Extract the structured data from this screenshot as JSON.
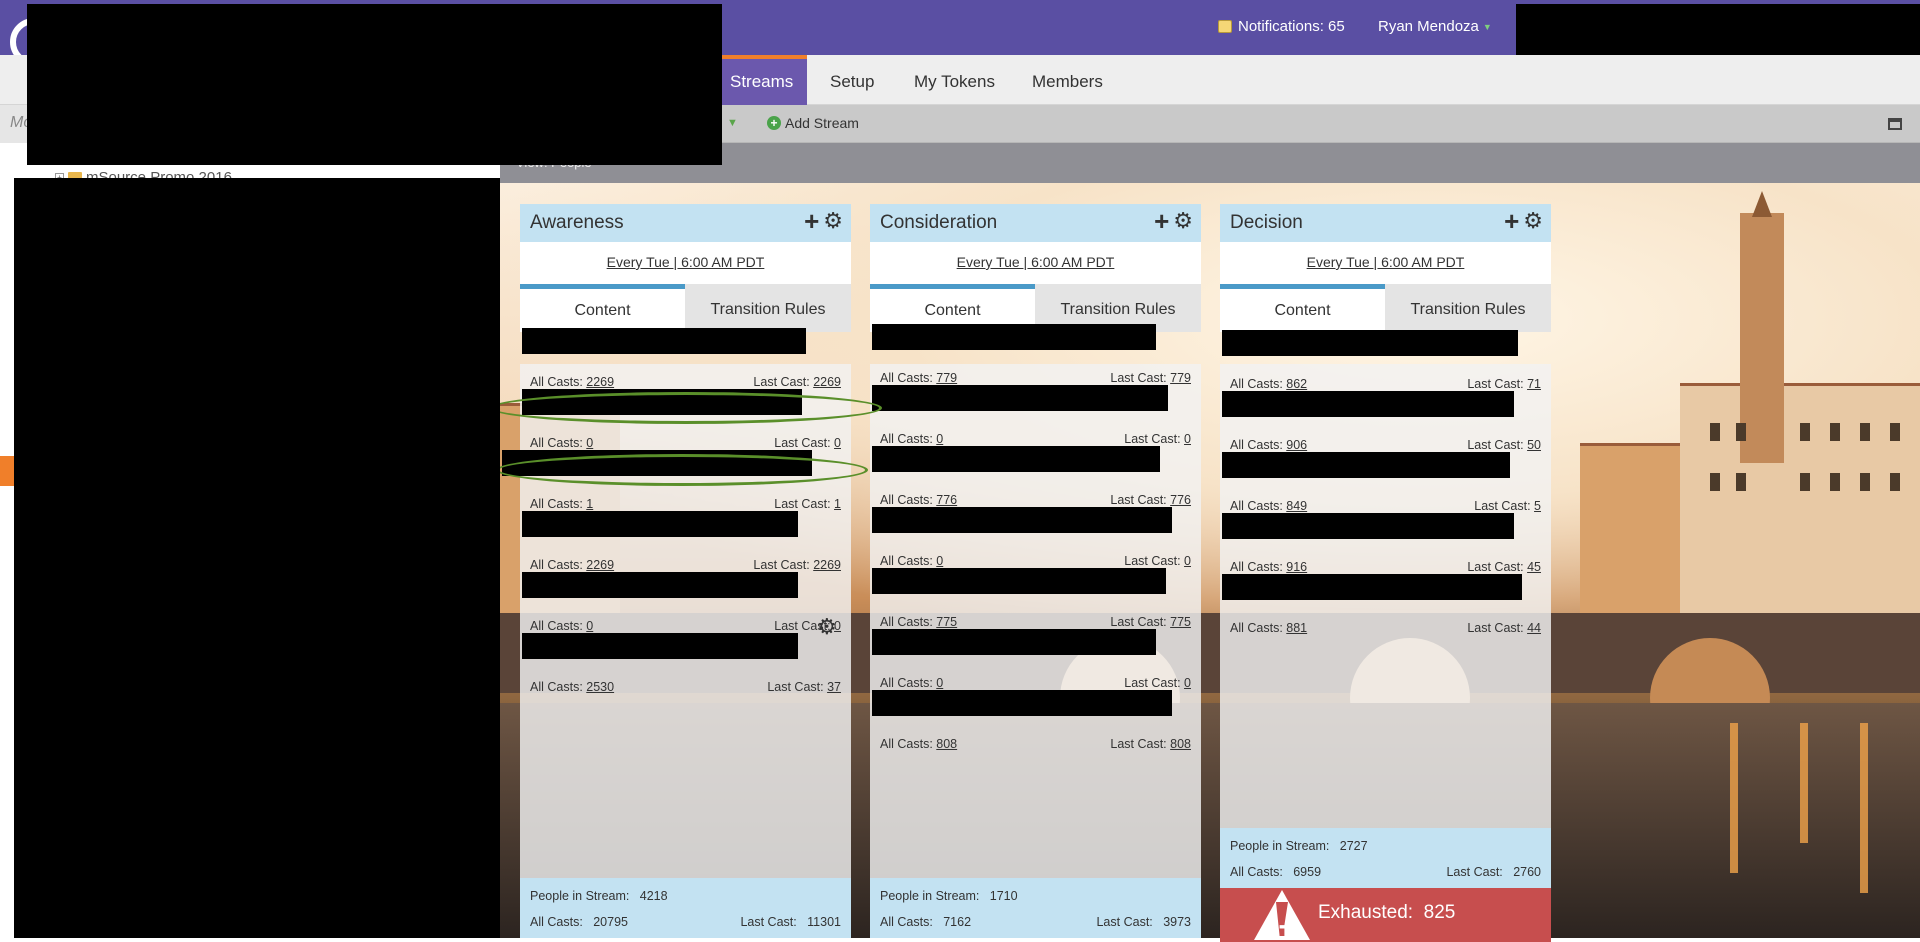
{
  "header": {
    "notifications_label": "Notifications: 65",
    "user_name": "Ryan Mendoza"
  },
  "nav": {
    "tabs": [
      "Streams",
      "Setup",
      "My Tokens",
      "Members"
    ],
    "active_tab": "Streams"
  },
  "toolbar": {
    "search_placeholder": "Mo",
    "add_stream_label": "Add Stream"
  },
  "viewbar": {
    "label": "View: People"
  },
  "sidebar": {
    "tree_item": "mSource Promo 2016"
  },
  "columns": [
    {
      "title": "Awareness",
      "schedule": "Every Tue | 6:00 AM PDT",
      "tabs": [
        "Content",
        "Transition Rules"
      ],
      "items": [
        {
          "all": "2269",
          "last": "2269"
        },
        {
          "all": "0",
          "last": "0"
        },
        {
          "all": "1",
          "last": "1"
        },
        {
          "all": "2269",
          "last": "2269"
        },
        {
          "all": "0",
          "last": "0"
        },
        {
          "all": "2530",
          "last": "37"
        }
      ],
      "people_in_stream": "4218",
      "all_casts_total": "20795",
      "last_cast_total": "11301"
    },
    {
      "title": "Consideration",
      "schedule": "Every Tue | 6:00 AM PDT",
      "tabs": [
        "Content",
        "Transition Rules"
      ],
      "items": [
        {
          "all": "779",
          "last": "779"
        },
        {
          "all": "0",
          "last": "0"
        },
        {
          "all": "776",
          "last": "776"
        },
        {
          "all": "0",
          "last": "0"
        },
        {
          "all": "775",
          "last": "775"
        },
        {
          "all": "0",
          "last": "0"
        },
        {
          "all": "808",
          "last": "808"
        }
      ],
      "people_in_stream": "1710",
      "all_casts_total": "7162",
      "last_cast_total": "3973"
    },
    {
      "title": "Decision",
      "schedule": "Every Tue | 6:00 AM PDT",
      "tabs": [
        "Content",
        "Transition Rules"
      ],
      "items": [
        {
          "all": "862",
          "last": "71"
        },
        {
          "all": "906",
          "last": "50"
        },
        {
          "all": "849",
          "last": "5"
        },
        {
          "all": "916",
          "last": "45"
        },
        {
          "all": "881",
          "last": "44"
        }
      ],
      "people_in_stream": "2727",
      "all_casts_total": "6959",
      "last_cast_total": "2760",
      "exhausted_label": "Exhausted:",
      "exhausted_count": "825"
    }
  ],
  "labels": {
    "all_casts": "All Casts:",
    "last_cast": "Last Cast:",
    "people_in_stream": "People in Stream:"
  },
  "colors": {
    "header_purple": "#5a4fa3",
    "active_tab_accent": "#f07f2a",
    "column_header_blue": "#c3e2f2",
    "exhausted_red": "#c74e4e",
    "highlight_oval_green": "#5a8f2a"
  }
}
